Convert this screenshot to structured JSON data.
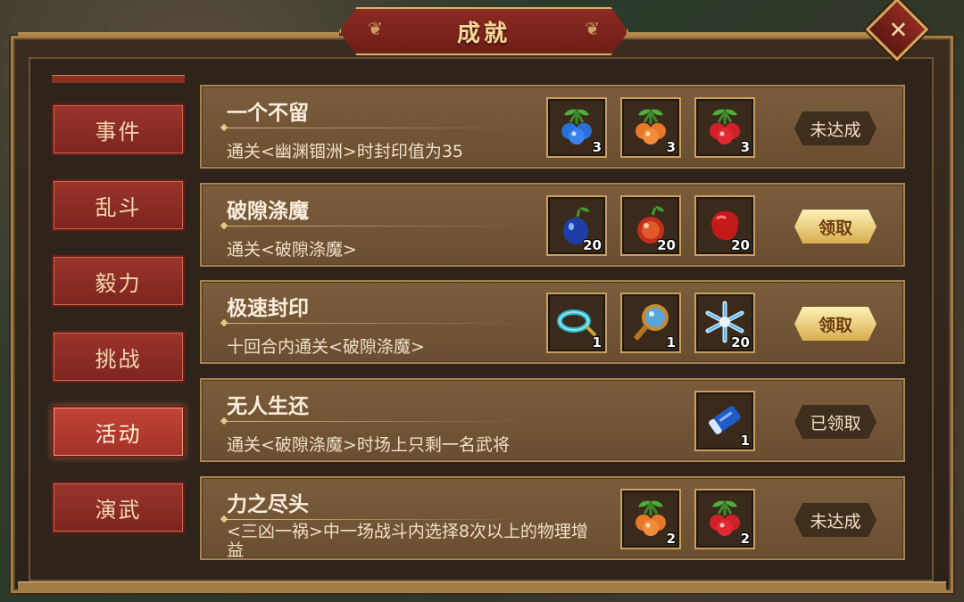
{
  "title": "成就",
  "nav": [
    {
      "label": "事件"
    },
    {
      "label": "乱斗"
    },
    {
      "label": "毅力"
    },
    {
      "label": "挑战"
    },
    {
      "label": "活动",
      "active": true
    },
    {
      "label": "演武"
    }
  ],
  "achievements": [
    {
      "title": "一个不留",
      "desc": "通关<幽渊锢洲>时封印值为35",
      "rewards": [
        {
          "icon": "blue-cherry-icon",
          "qty": "3"
        },
        {
          "icon": "orange-cherry-icon",
          "qty": "3"
        },
        {
          "icon": "red-cherry-icon",
          "qty": "3"
        }
      ],
      "status": "未达成"
    },
    {
      "title": "破隙涤魔",
      "desc": "通关<破隙涤魔>",
      "rewards": [
        {
          "icon": "blue-fruit-icon",
          "qty": "20"
        },
        {
          "icon": "red-fruit-icon",
          "qty": "20"
        },
        {
          "icon": "red-pepper-icon",
          "qty": "20"
        }
      ],
      "status": "领取"
    },
    {
      "title": "极速封印",
      "desc": "十回合内通关<破隙涤魔>",
      "rewards": [
        {
          "icon": "jade-ring-icon",
          "qty": "1"
        },
        {
          "icon": "mirror-icon",
          "qty": "1"
        },
        {
          "icon": "ice-crystal-icon",
          "qty": "20"
        }
      ],
      "status": "领取"
    },
    {
      "title": "无人生还",
      "desc": "通关<破隙涤魔>时场上只剩一名武将",
      "rewards": [
        {
          "icon": "blue-scroll-icon",
          "qty": "1"
        }
      ],
      "status": "已领取"
    },
    {
      "title": "力之尽头",
      "desc": "<三凶一祸>中一场战斗内选择8次以上的物理增益",
      "rewards": [
        {
          "icon": "orange-cherry-icon",
          "qty": "2"
        },
        {
          "icon": "red-cherry-icon",
          "qty": "2"
        }
      ],
      "status": "未达成"
    }
  ]
}
